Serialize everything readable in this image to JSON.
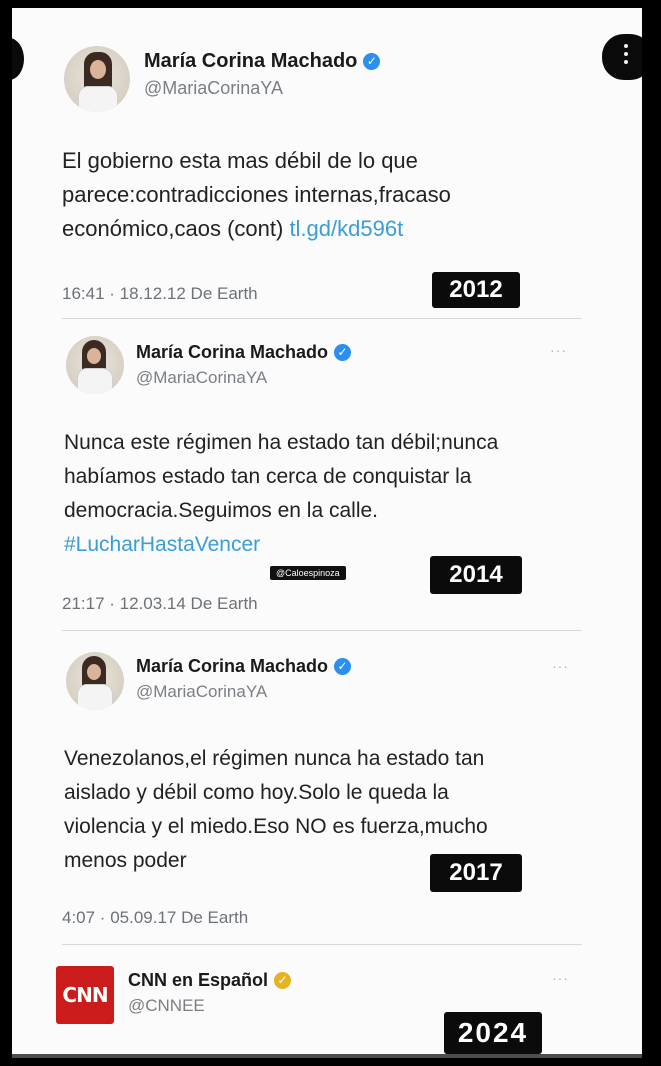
{
  "tweets": [
    {
      "name": "María Corina Machado",
      "handle": "@MariaCorinaYA",
      "text_lines": [
        "El gobierno esta mas débil de lo que",
        "parece:contradicciones internas,fracaso"
      ],
      "text_last": "económico,caos (cont) ",
      "link": "tl.gd/kd596t",
      "meta": "16:41 · 18.12.12 De Earth",
      "year": "2012"
    },
    {
      "name": "María Corina Machado",
      "handle": "@MariaCorinaYA",
      "more": "···",
      "text_lines": [
        "Nunca este régimen ha estado tan débil;nunca",
        "habíamos estado tan cerca de conquistar la",
        "democracia.Seguimos en la calle."
      ],
      "hashtag": "#LucharHastaVencer",
      "watermark": "@Caloespinoza",
      "meta": "21:17 · 12.03.14 De Earth",
      "year": "2014"
    },
    {
      "name": "María Corina Machado",
      "handle": "@MariaCorinaYA",
      "more": "···",
      "text_lines": [
        "Venezolanos,el régimen nunca ha estado tan",
        "aislado y débil como hoy.Solo le queda la",
        "violencia y el miedo.Eso NO es fuerza,mucho",
        "menos poder"
      ],
      "meta": "4:07 · 05.09.17 De Earth",
      "year": "2017"
    },
    {
      "name": "CNN en Español",
      "handle": "@CNNEE",
      "more": "···",
      "logo_text": "CNN",
      "year": "2024"
    }
  ],
  "colors": {
    "verified": "#2a8ff0",
    "verified_gold": "#e6b422",
    "link": "#3a9dd9",
    "cnn_red": "#cc1b1b"
  }
}
